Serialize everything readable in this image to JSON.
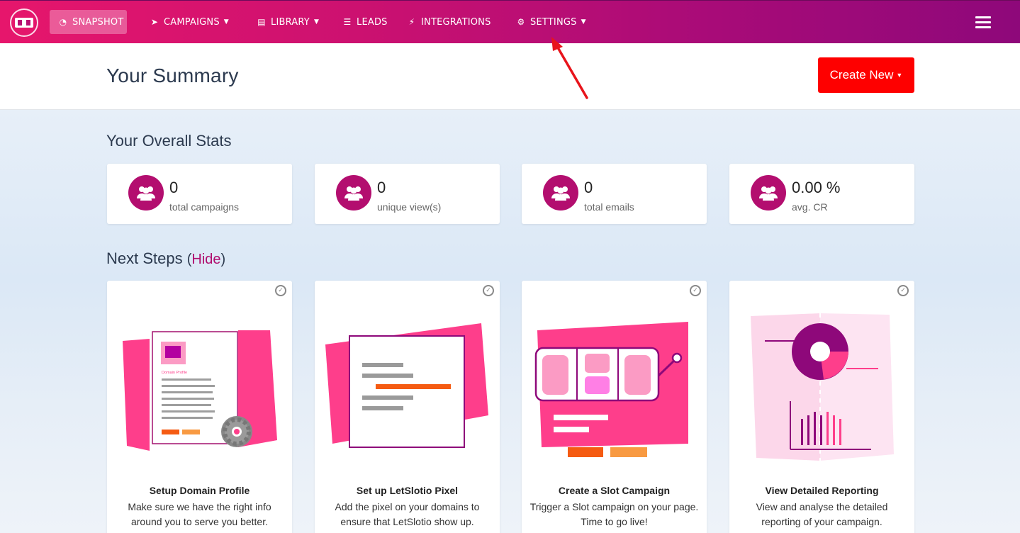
{
  "nav": {
    "snapshot": "SNAPSHOT",
    "campaigns": "CAMPAIGNS",
    "library": "LIBRARY",
    "leads": "LEADS",
    "integrations": "INTEGRATIONS",
    "settings": "SETTINGS"
  },
  "header": {
    "title": "Your Summary",
    "create_button": "Create New"
  },
  "stats": {
    "title": "Your Overall Stats",
    "items": [
      {
        "value": "0",
        "label": "total campaigns"
      },
      {
        "value": "0",
        "label": "unique view(s)"
      },
      {
        "value": "0",
        "label": "total emails"
      },
      {
        "value": "0.00 %",
        "label": "avg. CR"
      }
    ]
  },
  "next_steps": {
    "title": "Next Steps",
    "open_paren": "(",
    "hide_link": "Hide",
    "close_paren": ")",
    "cards": [
      {
        "title": "Setup Domain Profile",
        "description": "Make sure we have the right info around you to serve you better.",
        "illustration_text": "Domain Profile"
      },
      {
        "title": "Set up LetSlotio Pixel",
        "description": "Add the pixel on your domains to ensure that LetSlotio show up."
      },
      {
        "title": "Create a Slot Campaign",
        "description": "Trigger a Slot campaign on your page. Time to go live!"
      },
      {
        "title": "View Detailed Reporting",
        "description": "View and analyse the detailed reporting of your campaign."
      }
    ]
  },
  "colors": {
    "nav_start": "#e6166c",
    "nav_end": "#8e087a",
    "accent": "#b30e6f",
    "create_button": "#fe0000",
    "annotation_arrow": "#e8141b"
  }
}
